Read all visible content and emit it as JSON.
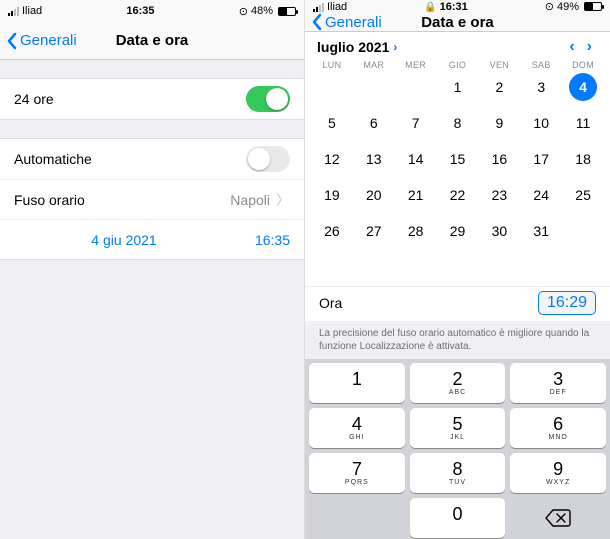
{
  "left": {
    "status": {
      "carrier": "Iliad",
      "time": "16:35",
      "battery_pct": "48%"
    },
    "nav": {
      "back": "Generali",
      "title": "Data e ora"
    },
    "row_24h": {
      "label": "24 ore",
      "value": true
    },
    "row_auto": {
      "label": "Automatiche",
      "value": false
    },
    "row_tz": {
      "label": "Fuso orario",
      "value": "Napoli"
    },
    "row_dt": {
      "date": "4 giu 2021",
      "time": "16:35"
    }
  },
  "right": {
    "status": {
      "carrier": "Iliad",
      "time": "16:31",
      "battery_pct": "49%"
    },
    "nav": {
      "back": "Generali",
      "title": "Data e ora"
    },
    "month": "luglio 2021",
    "weekdays": [
      "LUN",
      "MAR",
      "MER",
      "GIO",
      "VEN",
      "SAB",
      "DOM"
    ],
    "days_grid": [
      "",
      "",
      "",
      "1",
      "2",
      "3",
      "4",
      "5",
      "6",
      "7",
      "8",
      "9",
      "10",
      "11",
      "12",
      "13",
      "14",
      "15",
      "16",
      "17",
      "18",
      "19",
      "20",
      "21",
      "22",
      "23",
      "24",
      "25",
      "26",
      "27",
      "28",
      "29",
      "30",
      "31",
      "",
      "",
      "",
      "",
      ""
    ],
    "selected_day": "4",
    "time_label": "Ora",
    "time_value": "16:29",
    "footer_note": "La precisione del fuso orario automatico è migliore quando la funzione Localizzazione è attivata.",
    "keypad": [
      {
        "n": "1",
        "l": ""
      },
      {
        "n": "2",
        "l": "ABC"
      },
      {
        "n": "3",
        "l": "DEF"
      },
      {
        "n": "4",
        "l": "GHI"
      },
      {
        "n": "5",
        "l": "JKL"
      },
      {
        "n": "6",
        "l": "MNO"
      },
      {
        "n": "7",
        "l": "PQRS"
      },
      {
        "n": "8",
        "l": "TUV"
      },
      {
        "n": "9",
        "l": "WXYZ"
      },
      {
        "n": "",
        "blank": true
      },
      {
        "n": "0",
        "l": ""
      },
      {
        "del": true
      }
    ]
  }
}
